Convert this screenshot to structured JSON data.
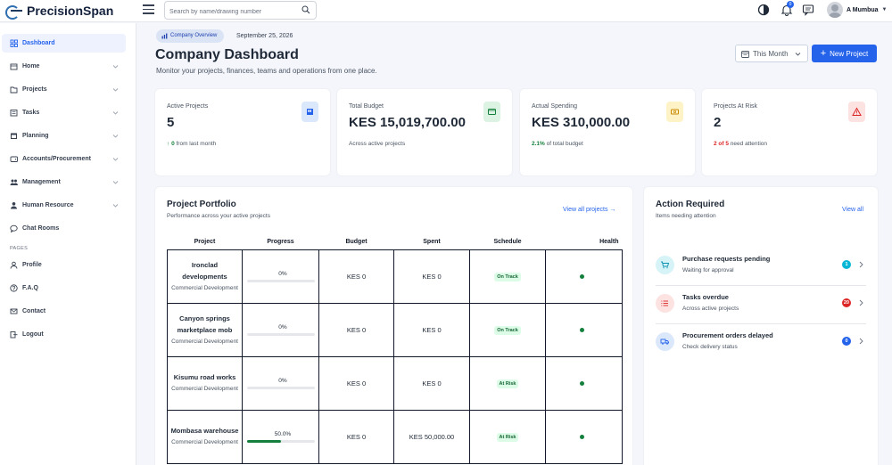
{
  "app": {
    "brand": "PrecisionSpan"
  },
  "header": {
    "search_placeholder": "Search by name/drawing number",
    "notification_count": "0",
    "user_name": "A Mumbua"
  },
  "sidebar": {
    "items": [
      {
        "label": "Dashboard",
        "icon": "grid-icon",
        "active": true
      },
      {
        "label": "Home",
        "icon": "home-icon",
        "expandable": true
      },
      {
        "label": "Projects",
        "icon": "folder-icon",
        "expandable": true
      },
      {
        "label": "Tasks",
        "icon": "list-icon",
        "expandable": true
      },
      {
        "label": "Planning",
        "icon": "calendar-icon",
        "expandable": true
      },
      {
        "label": "Accounts/Procurement",
        "icon": "wallet-icon",
        "expandable": true
      },
      {
        "label": "Management",
        "icon": "users-icon",
        "expandable": true
      },
      {
        "label": "Human Resource",
        "icon": "user-tie-icon",
        "expandable": true
      },
      {
        "label": "Chat Rooms",
        "icon": "chat-icon"
      }
    ],
    "section_label": "PAGES",
    "pages": [
      {
        "label": "Profile",
        "icon": "person-icon"
      },
      {
        "label": "F.A.Q",
        "icon": "help-icon"
      },
      {
        "label": "Contact",
        "icon": "mail-icon"
      },
      {
        "label": "Logout",
        "icon": "logout-icon"
      }
    ]
  },
  "page": {
    "breadcrumb": "Company Overview",
    "date": "September 25, 2026",
    "title": "Company Dashboard",
    "subtitle": "Monitor your projects, finances, teams and operations from one place.",
    "period_select": "This Month",
    "new_project_label": "New Project"
  },
  "stats": [
    {
      "label": "Active Projects",
      "value": "5",
      "foot_strong": "0",
      "foot_text": "from last month",
      "icon": "briefcase-icon",
      "accent": "#2563eb",
      "tint": "#dbe7fb"
    },
    {
      "label": "Total Budget",
      "value": "KES 15,019,700.00",
      "foot_strong": "",
      "foot_text": "Across active projects",
      "icon": "wallet-icon",
      "accent": "#15803d",
      "tint": "#dcf2e3"
    },
    {
      "label": "Actual Spending",
      "value": "KES 310,000.00",
      "foot_strong": "2.1%",
      "foot_text": "of total budget",
      "icon": "money-icon",
      "accent": "#ca8a04",
      "tint": "#fdf3c7"
    },
    {
      "label": "Projects At Risk",
      "value": "2",
      "foot_strong": "2 of 5",
      "foot_text": "need attention",
      "icon": "warning-icon",
      "accent": "#dc2626",
      "tint": "#fde2e2"
    }
  ],
  "portfolio": {
    "title": "Project Portfolio",
    "subtitle": "Performance across your active projects",
    "view_all": "View all projects",
    "columns": [
      "Project",
      "Progress",
      "Budget",
      "Spent",
      "Schedule",
      "Health"
    ],
    "rows": [
      {
        "name": "Ironclad developments",
        "category": "Commercial Development",
        "progress_label": "0%",
        "progress": 0,
        "budget": "KES 0",
        "spent": "KES 0",
        "schedule": "On Track",
        "schedule_kind": "on"
      },
      {
        "name": "Canyon springs marketplace mob",
        "category": "Commercial Development",
        "progress_label": "0%",
        "progress": 0,
        "budget": "KES 0",
        "spent": "KES 0",
        "schedule": "On Track",
        "schedule_kind": "on"
      },
      {
        "name": "Kisumu road works",
        "category": "Commercial Development",
        "progress_label": "0%",
        "progress": 0,
        "budget": "KES 0",
        "spent": "KES 0",
        "schedule": "At Risk",
        "schedule_kind": "risk"
      },
      {
        "name": "Mombasa warehouse",
        "category": "Commercial Development",
        "progress_label": "50.0%",
        "progress": 50,
        "budget": "KES 0",
        "spent": "KES 50,000.00",
        "schedule": "At Risk",
        "schedule_kind": "risk"
      }
    ],
    "health_color": "#15803d"
  },
  "actions": {
    "title": "Action Required",
    "subtitle": "Items needing attention",
    "view_all": "View all",
    "items": [
      {
        "title": "Purchase requests pending",
        "sub": "Waiting for approval",
        "count": "1",
        "icon": "cart-icon",
        "accent": "#0891b2",
        "tint": "#d6f3f7",
        "badge": "#06b6d4"
      },
      {
        "title": "Tasks overdue",
        "sub": "Across active projects",
        "count": "20",
        "icon": "tasks-icon",
        "accent": "#dc2626",
        "tint": "#fde2e2",
        "badge": "#dc2626"
      },
      {
        "title": "Procurement orders delayed",
        "sub": "Check delivery status",
        "count": "0",
        "icon": "truck-icon",
        "accent": "#2563eb",
        "tint": "#dbe7fb",
        "badge": "#2563eb"
      }
    ]
  }
}
